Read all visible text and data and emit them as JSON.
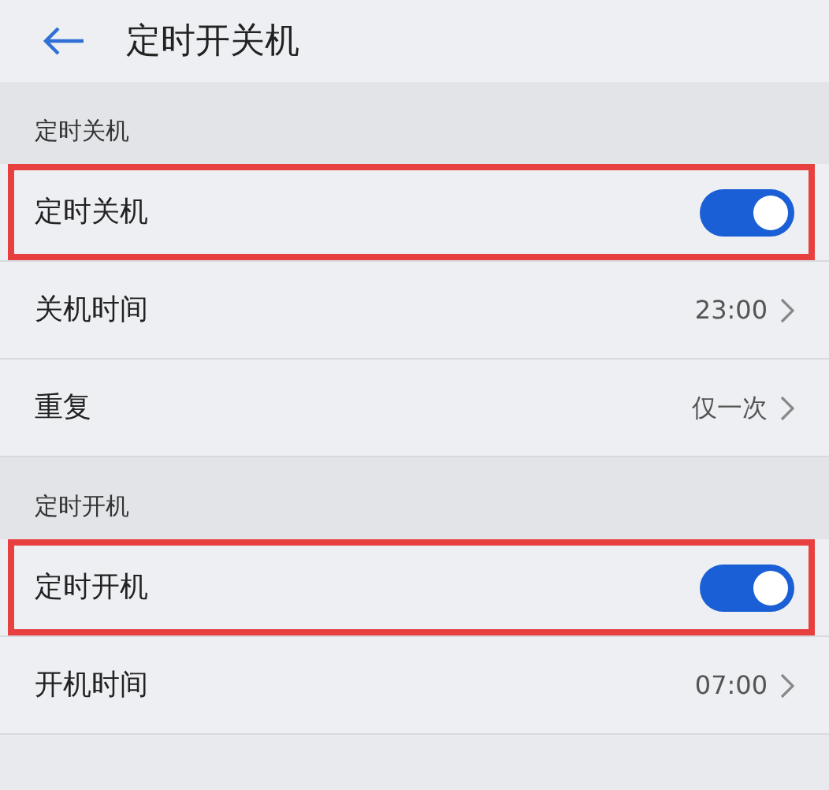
{
  "header": {
    "title": "定时开关机"
  },
  "sections": [
    {
      "header": "定时关机",
      "rows": [
        {
          "kind": "toggle",
          "label": "定时关机",
          "on": true,
          "highlighted": true
        },
        {
          "kind": "value",
          "label": "关机时间",
          "value": "23:00",
          "highlighted": false
        },
        {
          "kind": "value",
          "label": "重复",
          "value": "仅一次",
          "highlighted": false
        }
      ]
    },
    {
      "header": "定时开机",
      "rows": [
        {
          "kind": "toggle",
          "label": "定时开机",
          "on": true,
          "highlighted": true
        },
        {
          "kind": "value",
          "label": "开机时间",
          "value": "07:00",
          "highlighted": false
        }
      ]
    }
  ]
}
